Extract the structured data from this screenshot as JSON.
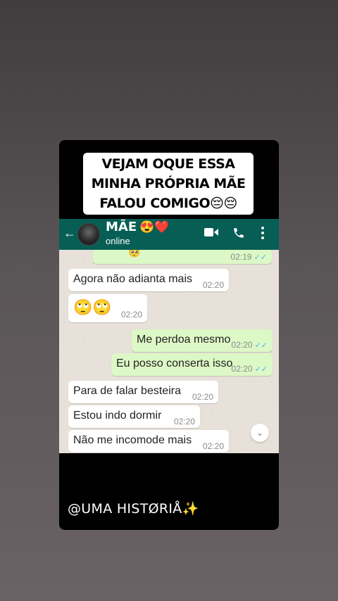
{
  "caption": {
    "line1": "VEJAM OQUE ESSA",
    "line2": "MINHA PRÓPRIA MÃE",
    "line3": "FALOU COMIGO😔😔"
  },
  "chat": {
    "contact_name": "MÃE",
    "contact_emoji": "😍❤️",
    "status": "online",
    "icons": [
      "back-arrow-icon",
      "video-call-icon",
      "phone-icon",
      "more-vert-icon",
      "chevron-down-icon"
    ],
    "partial_prev": {
      "emoji": "🥺",
      "time": "02:19"
    },
    "messages": [
      {
        "dir": "in",
        "text": "Agora não adianta mais",
        "time": "02:20"
      },
      {
        "dir": "in",
        "text": "🙄🙄",
        "time": "02:20"
      },
      {
        "dir": "out",
        "text": "Me perdoa mesmo",
        "time": "02:20"
      },
      {
        "dir": "out",
        "text": "Eu posso conserta isso",
        "time": "02:20"
      },
      {
        "dir": "in",
        "text": "Para de falar besteira",
        "time": "02:20"
      },
      {
        "dir": "in",
        "text": "Estou indo dormir",
        "time": "02:20"
      },
      {
        "dir": "in",
        "text": "Não me incomode mais",
        "time": "02:20"
      }
    ]
  },
  "footer": "@UMA HISTØRIÅ✨",
  "colors": {
    "header": "#075e54",
    "outgoing": "#dcf8c6",
    "incoming": "#ffffff",
    "chat_bg": "#e7e1da"
  }
}
